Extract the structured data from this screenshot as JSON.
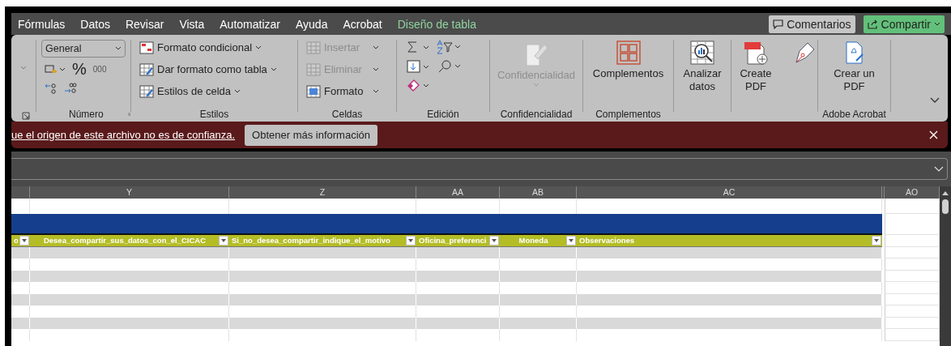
{
  "tabs": [
    {
      "label": "Fórmulas",
      "kind": "normal"
    },
    {
      "label": "Datos",
      "kind": "normal"
    },
    {
      "label": "Revisar",
      "kind": "normal"
    },
    {
      "label": "Vista",
      "kind": "normal"
    },
    {
      "label": "Automatizar",
      "kind": "normal"
    },
    {
      "label": "Ayuda",
      "kind": "normal"
    },
    {
      "label": "Acrobat",
      "kind": "normal"
    },
    {
      "label": "Diseño de tabla",
      "kind": "contextual"
    }
  ],
  "top_buttons": {
    "comments": "Comentarios",
    "share": "Compartir"
  },
  "ribbon": {
    "number": {
      "format": "General",
      "percent": "%",
      "thousands": "000",
      "label": "Número"
    },
    "styles": {
      "items": [
        "Formato condicional",
        "Dar formato como tabla",
        "Estilos de celda"
      ],
      "label": "Estilos"
    },
    "cells": {
      "items": [
        {
          "label": "Insertar",
          "disabled": true
        },
        {
          "label": "Eliminar",
          "disabled": true
        },
        {
          "label": "Formato",
          "disabled": false
        }
      ],
      "label": "Celdas"
    },
    "editing": {
      "label": "Edición"
    },
    "sensitivity": {
      "button": "Confidencialidad",
      "disabled": true,
      "label": "Confidencialidad"
    },
    "addins": {
      "button": "Complementos",
      "label": "Complementos"
    },
    "analyze": {
      "button": "Analizar datos"
    },
    "create_pdf": {
      "button": "Create PDF"
    },
    "acrobat": {
      "button": "Crear un PDF",
      "label": "Adobe Acrobat"
    }
  },
  "message_bar": {
    "text": "ue el origen de este archivo no es de confianza.",
    "button": "Obtener más información"
  },
  "columns": [
    "Y",
    "Z",
    "AA",
    "AB",
    "AC"
  ],
  "extra_column": "AO",
  "table_headers": [
    "o",
    "Desea_compartir_sus_datos_con_el_CICAC",
    "Si_no_desea_compartir_indique_el_motivo",
    "Oficina_preferenci",
    "Moneda",
    "Observaciones"
  ]
}
